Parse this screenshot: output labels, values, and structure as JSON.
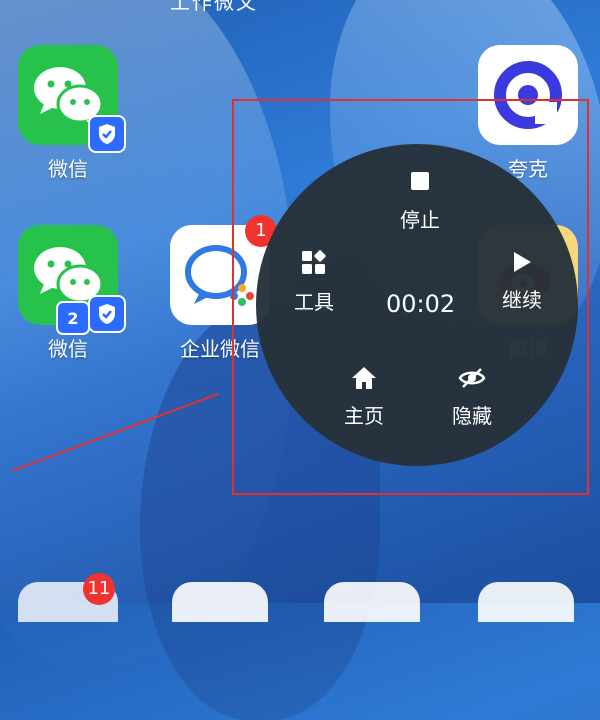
{
  "wallpaper": {
    "top_text": "工作微文"
  },
  "apps": [
    {
      "label": "微信",
      "badge": "shield"
    },
    {
      "label": "夸克"
    },
    {
      "label": "微信",
      "badge": "clone-2"
    },
    {
      "label": "企业微信",
      "notification": "1"
    },
    {
      "label": "微博"
    }
  ],
  "dock": {
    "folder_notification": "11"
  },
  "floating_menu": {
    "stop_label": "停止",
    "tools_label": "工具",
    "timer": "00:02",
    "continue_label": "继续",
    "home_label": "主页",
    "hide_label": "隐藏"
  },
  "annotation": {
    "color": "#e03030"
  },
  "colors": {
    "wechat": "#27c24c",
    "menu_bg": "#26323a",
    "badge_red": "#f0332f",
    "accent_blue": "#2b6bff"
  },
  "icons": [
    "stop-icon",
    "tools-icon",
    "play-icon",
    "home-icon",
    "hide-eye-icon",
    "shield-icon"
  ]
}
